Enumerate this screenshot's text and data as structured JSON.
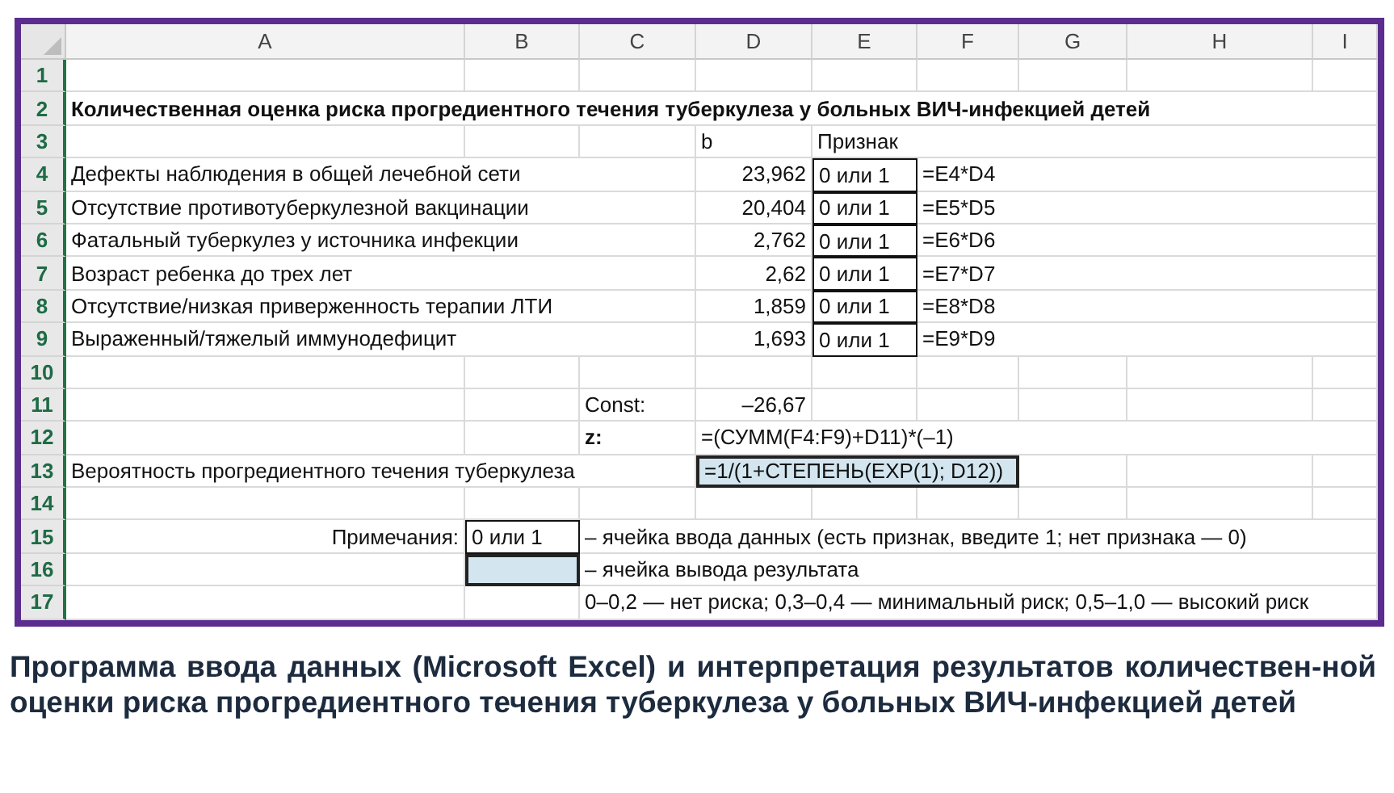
{
  "sheet": {
    "columns": [
      "A",
      "B",
      "C",
      "D",
      "E",
      "F",
      "G",
      "H",
      "I"
    ],
    "rows": [
      {
        "number": "1",
        "cells": {}
      },
      {
        "number": "2",
        "cells": {
          "A": {
            "text": "Количественная оценка риска прогредиентного течения туберкулеза у больных ВИЧ-инфекцией детей",
            "kind": "title"
          }
        }
      },
      {
        "number": "3",
        "cells": {
          "D": {
            "text": "b",
            "kind": "text"
          },
          "E": {
            "text": "Признак",
            "kind": "text"
          }
        }
      },
      {
        "number": "4",
        "cells": {
          "A": {
            "text": "Дефекты наблюдения в общей лечебной сети",
            "kind": "text"
          },
          "D": {
            "text": "23,962",
            "kind": "number"
          },
          "E": {
            "text": "0 или 1",
            "kind": "input"
          },
          "F": {
            "text": "=E4*D4",
            "kind": "text"
          }
        }
      },
      {
        "number": "5",
        "cells": {
          "A": {
            "text": "Отсутствие противотуберкулезной вакцинации",
            "kind": "text"
          },
          "D": {
            "text": "20,404",
            "kind": "number"
          },
          "E": {
            "text": "0 или 1",
            "kind": "input"
          },
          "F": {
            "text": "=E5*D5",
            "kind": "text"
          }
        }
      },
      {
        "number": "6",
        "cells": {
          "A": {
            "text": "Фатальный туберкулез у источника инфекции",
            "kind": "text"
          },
          "D": {
            "text": "2,762",
            "kind": "number"
          },
          "E": {
            "text": "0 или 1",
            "kind": "input"
          },
          "F": {
            "text": "=E6*D6",
            "kind": "text"
          }
        }
      },
      {
        "number": "7",
        "cells": {
          "A": {
            "text": "Возраст ребенка до трех лет",
            "kind": "text"
          },
          "D": {
            "text": "2,62",
            "kind": "number"
          },
          "E": {
            "text": "0 или 1",
            "kind": "input"
          },
          "F": {
            "text": "=E7*D7",
            "kind": "text"
          }
        }
      },
      {
        "number": "8",
        "cells": {
          "A": {
            "text": "Отсутствие/низкая приверженность терапии ЛТИ",
            "kind": "text"
          },
          "D": {
            "text": "1,859",
            "kind": "number"
          },
          "E": {
            "text": "0 или 1",
            "kind": "input"
          },
          "F": {
            "text": "=E8*D8",
            "kind": "text"
          }
        }
      },
      {
        "number": "9",
        "cells": {
          "A": {
            "text": "Выраженный/тяжелый иммунодефицит",
            "kind": "text"
          },
          "D": {
            "text": "1,693",
            "kind": "number"
          },
          "E": {
            "text": "0 или 1",
            "kind": "input"
          },
          "F": {
            "text": "=E9*D9",
            "kind": "text"
          }
        }
      },
      {
        "number": "10",
        "cells": {}
      },
      {
        "number": "11",
        "cells": {
          "C": {
            "text": "Const:",
            "kind": "text"
          },
          "D": {
            "text": "–26,67",
            "kind": "number"
          }
        }
      },
      {
        "number": "12",
        "cells": {
          "C": {
            "text": "z:",
            "kind": "title"
          },
          "D": {
            "text": "=(СУММ(F4:F9)+D11)*(–1)",
            "kind": "text"
          }
        }
      },
      {
        "number": "13",
        "cells": {
          "A": {
            "text": "Вероятность прогредиентного течения туберкулеза",
            "kind": "text"
          },
          "D": {
            "text": "=1/(1+СТЕПЕНЬ(EXP(1); D12))",
            "kind": "output"
          },
          "E": {
            "kind": "merged"
          },
          "F": {
            "kind": "merged"
          }
        }
      },
      {
        "number": "14",
        "cells": {}
      },
      {
        "number": "15",
        "cells": {
          "A": {
            "text": "Примечания:",
            "kind": "number"
          },
          "B": {
            "text": "0 или 1",
            "kind": "input"
          },
          "C": {
            "text": "– ячейка ввода данных (есть признак, введите 1; нет признака — 0)",
            "kind": "text"
          }
        }
      },
      {
        "number": "16",
        "cells": {
          "B": {
            "kind": "output"
          },
          "C": {
            "text": "– ячейка вывода результата",
            "kind": "text"
          }
        }
      },
      {
        "number": "17",
        "cells": {
          "C": {
            "text": "0–0,2 — нет риска; 0,3–0,4 — минимальный риск; 0,5–1,0 — высокий риск",
            "kind": "text"
          }
        }
      }
    ]
  },
  "caption": "Программа ввода данных (Microsoft Excel) и интерпретация результатов количествен-ной оценки риска прогредиентного течения туберкулеза у больных ВИЧ-инфекцией детей"
}
